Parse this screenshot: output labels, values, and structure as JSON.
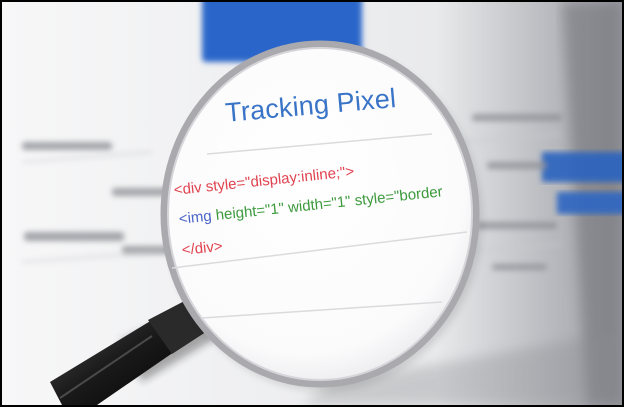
{
  "title": "Tracking Pixel",
  "code_lines": [
    {
      "open": "<div",
      "attr": " style=\"display:inline;\">"
    },
    {
      "open": "<img",
      "attr": " height=\"1\" width=\"1\" style=\"border"
    },
    {
      "open": "</div>",
      "attr": ""
    }
  ],
  "colors": {
    "title": "#3a74c7",
    "tag_red": "#e0434f",
    "tag_blue": "#4a65c6",
    "attr_green": "#3c9a3c",
    "lens_rim": "#b9b9bd",
    "handle": "#1e1e1e"
  }
}
